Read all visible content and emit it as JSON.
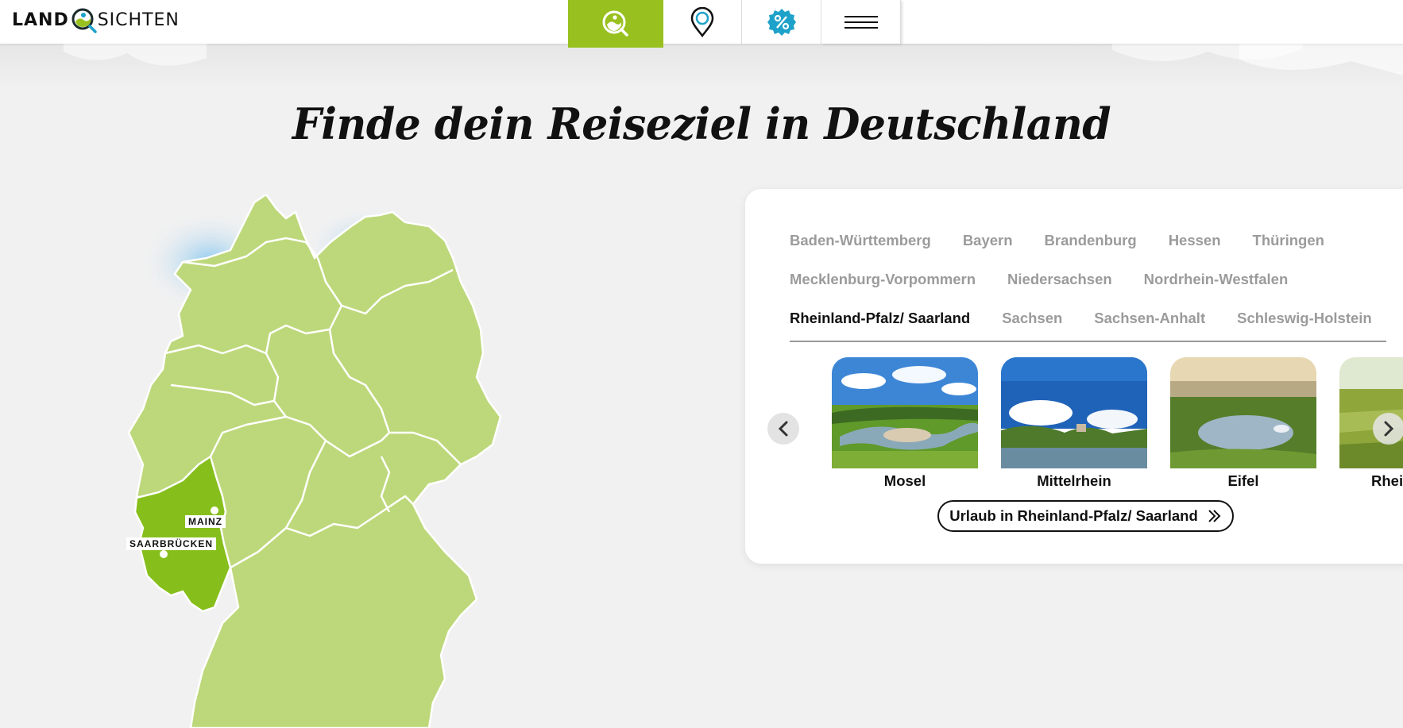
{
  "header": {
    "logo_left": "LAND",
    "logo_right": "SICHTEN",
    "nav": [
      {
        "icon": "search-icon",
        "active": true
      },
      {
        "icon": "map-pin-icon",
        "active": false
      },
      {
        "icon": "percent-badge-icon",
        "active": false
      },
      {
        "icon": "menu-icon",
        "active": false
      }
    ]
  },
  "headline": "Finde dein Reiseziel in Deutschland",
  "map": {
    "labels": {
      "mainz": "MAINZ",
      "saarbruecken": "SAARBRÜCKEN"
    },
    "highlighted_region": "Rheinland-Pfalz/ Saarland",
    "colors": {
      "land": "#bdd87a",
      "highlight": "#86bf1c",
      "water": "#8fcaf0",
      "border": "#ffffff"
    }
  },
  "regions_panel": {
    "tabs": [
      "Baden-Württemberg",
      "Bayern",
      "Brandenburg",
      "Hessen",
      "Thüringen",
      "Mecklenburg-Vorpommern",
      "Niedersachsen",
      "Nordrhein-Westfalen",
      "Rheinland-Pfalz/ Saarland",
      "Sachsen",
      "Sachsen-Anhalt",
      "Schleswig-Holstein"
    ],
    "active_tab": "Rheinland-Pfalz/ Saarland",
    "slides": [
      "Mosel",
      "Mittelrhein",
      "Eifel",
      "Rhei"
    ],
    "cta_label": "Urlaub in Rheinland-Pfalz/ Saarland"
  },
  "colors": {
    "accent": "#98c11f",
    "teal": "#1ea2c9",
    "tab_inactive": "#9b9b9b",
    "active_underline": "#c5e3a0"
  }
}
